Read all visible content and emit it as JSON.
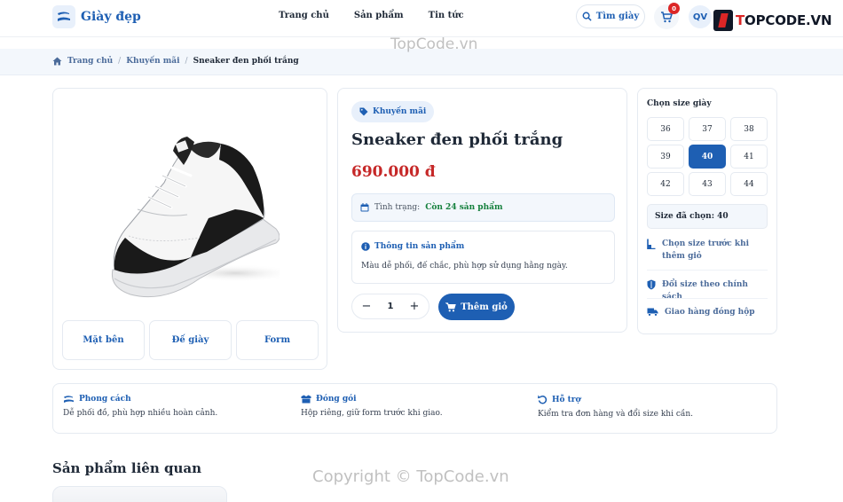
{
  "header": {
    "logo_text": "Giày đẹp",
    "nav": [
      "Trang chủ",
      "Sản phẩm",
      "Tin tức"
    ],
    "search_label": "Tìm giày",
    "cart_count": "0",
    "avatar_initials": "QV",
    "watermark_logo": {
      "part1": "T",
      "part2": "OPCODE.VN"
    }
  },
  "breadcrumb": {
    "home": "Trang chủ",
    "category": "Khuyến mãi",
    "current": "Sneaker đen phối trắng"
  },
  "gallery": {
    "thumbnails": [
      "Mặt bên",
      "Đế giày",
      "Form"
    ]
  },
  "product": {
    "badge": "Khuyến mãi",
    "title": "Sneaker đen phối trắng",
    "price": "690.000 đ",
    "stock_label": "Tình trạng:",
    "stock_value": "Còn 24 sản phẩm",
    "info_title": "Thông tin sản phẩm",
    "info_text": "Màu dễ phối, đế chắc, phù hợp sử dụng hằng ngày.",
    "quantity": "1",
    "add_to_cart": "Thêm giỏ"
  },
  "sizes": {
    "title": "Chọn size giày",
    "options": [
      "36",
      "37",
      "38",
      "39",
      "40",
      "41",
      "42",
      "43",
      "44"
    ],
    "selected": "40",
    "picked_text": "Size đã chọn: 40",
    "perks": [
      {
        "icon": "ruler-icon",
        "text": "Chọn size trước khi thêm giỏ"
      },
      {
        "icon": "shield-icon",
        "text": "Đổi size theo chính sách"
      },
      {
        "icon": "truck-icon",
        "text": "Giao hàng đóng hộp"
      }
    ]
  },
  "features": [
    {
      "icon": "shoe-icon",
      "title": "Phong cách",
      "text": "Dễ phối đồ, phù hợp nhiều hoàn cảnh."
    },
    {
      "icon": "box-icon",
      "title": "Đóng gói",
      "text": "Hộp riêng, giữ form trước khi giao."
    },
    {
      "icon": "undo-icon",
      "title": "Hỗ trợ",
      "text": "Kiểm tra đơn hàng và đổi size khi cần."
    }
  ],
  "related": {
    "title": "Sản phẩm liên quan"
  },
  "watermarks": {
    "top": "TopCode.vn",
    "bottom": "Copyright © TopCode.vn"
  },
  "colors": {
    "primary": "#1e5fb3",
    "price": "#c62828",
    "stock": "#15803d",
    "badge_bg": "#e8f0fb"
  }
}
